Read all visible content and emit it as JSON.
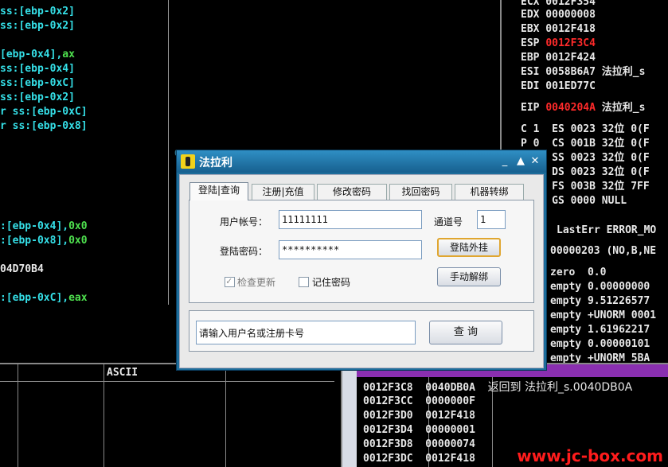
{
  "disasm": {
    "lines": [
      "ss:[ebp-0x2]",
      "ss:[ebp-0x2]",
      "",
      "[ebp-0x4],",
      "ss:[ebp-0x4]",
      "ss:[ebp-0xC]",
      "ss:[ebp-0x2]",
      "r ss:[ebp-0xC]",
      "r ss:[ebp-0x8]",
      ":[ebp-0x4],",
      ":[ebp-0x8],",
      "04D70B4",
      ":[ebp-0xC],"
    ],
    "green_parts": {
      "l3": "ax",
      "l9": "0x0",
      "l10": "0x0",
      "l12": "eax"
    },
    "overlay_text": "0040204A"
  },
  "registers": {
    "lines": [
      "ECX 0012F354",
      "EDX 00000008",
      "EBX 0012F418",
      "ESP",
      "EBP 0012F424",
      "ESI 0058B6A7 法拉利_s",
      "EDI 001ED77C",
      "EIP",
      "C 1  ES 0023 32位 0(F",
      "P 0  CS 001B 32位 0(F",
      "A 0  SS 0023 32位 0(F",
      "Z 1  DS 0023 32位 0(F",
      "S 0  FS 003B 32位 7FF",
      "T 0  GS 0000 NULL",
      "LastErr ERROR_MO",
      "00000203 (NO,B,NE",
      "zero  0.0",
      "empty 0.00000000",
      "empty 9.51226577",
      "empty +UNORM 0001",
      "empty 1.61962217",
      "empty 0.00000101",
      "empty +UNORM 5BA"
    ],
    "esp_value": "0012F3C4",
    "eip_value": "0040204A",
    "eip_suffix": " 法拉利_s"
  },
  "hexdump": {
    "ascii_header": "ASCII"
  },
  "stack": {
    "rows": [
      {
        "addr": "0012F3C8",
        "val": "0040DB0A",
        "comment": "返回到 法拉利_s.0040DB0A"
      },
      {
        "addr": "0012F3CC",
        "val": "0000000F",
        "comment": ""
      },
      {
        "addr": "0012F3D0",
        "val": "0012F418",
        "comment": ""
      },
      {
        "addr": "0012F3D4",
        "val": "00000001",
        "comment": ""
      },
      {
        "addr": "0012F3D8",
        "val": "00000074",
        "comment": ""
      },
      {
        "addr": "0012F3DC",
        "val": "0012F418",
        "comment": ""
      }
    ],
    "watermark": "www.jc-box.com"
  },
  "dialog": {
    "title": "法拉利",
    "tabs": [
      "登陆|查询",
      "注册|充值",
      "修改密码",
      "找回密码",
      "机器转绑"
    ],
    "account_label": "用户帐号：",
    "account_value": "11111111",
    "password_label": "登陆密码：",
    "password_value": "**********",
    "channel_label": "通道号",
    "channel_value": "1",
    "login_button": "登陆外挂",
    "unbind_button": "手动解绑",
    "check_update_label": "检查更新",
    "check_update_checked": true,
    "remember_label": "记住密码",
    "remember_checked": false,
    "query_input": "请输入用户名或注册卡号",
    "query_button": "查 询"
  }
}
